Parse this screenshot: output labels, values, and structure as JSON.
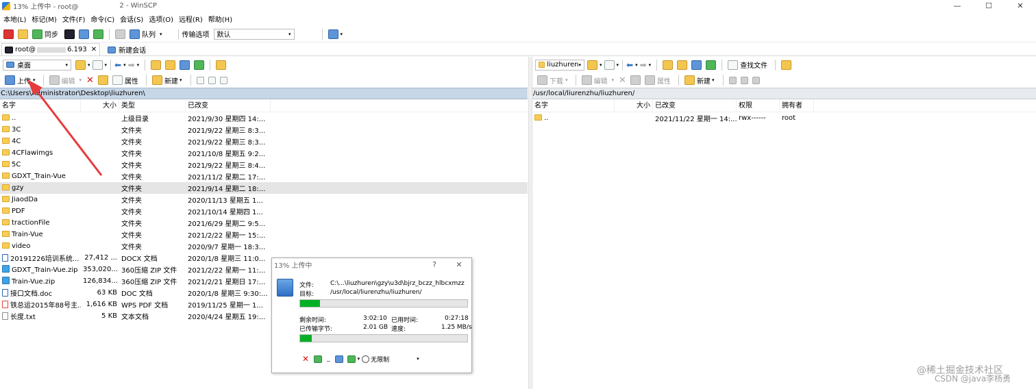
{
  "window": {
    "title": "13% 上传中 - root@",
    "title_tail": "2 - WinSCP",
    "controls": [
      "—",
      "☐",
      "✕"
    ]
  },
  "menu": [
    "本地(L)",
    "标记(M)",
    "文件(F)",
    "命令(C)",
    "会话(S)",
    "选项(O)",
    "远程(R)",
    "帮助(H)"
  ],
  "toolbar": {
    "sync_label": "同步",
    "queue_label": "队列",
    "transfer_label": "传输选项",
    "transfer_value": "默认"
  },
  "tabs": [
    {
      "label": "root@",
      "label_tail": "6.193"
    },
    {
      "label": "新建会话"
    }
  ],
  "left": {
    "location": "桌面",
    "upload_label": "上传",
    "edit_label": "编辑",
    "properties_label": "属性",
    "new_label": "新建",
    "path": "C:\\Users\\Administrator\\Desktop\\liuzhuren\\",
    "columns": [
      "名字",
      "大小",
      "类型",
      "已改变"
    ],
    "rows": [
      {
        "icon": "up",
        "name": "..",
        "size": "",
        "type": "上级目录",
        "date": "2021/9/30 星期四 14:..."
      },
      {
        "icon": "folder",
        "name": "3C",
        "size": "",
        "type": "文件夹",
        "date": "2021/9/22 星期三 8:3..."
      },
      {
        "icon": "folder",
        "name": "4C",
        "size": "",
        "type": "文件夹",
        "date": "2021/9/22 星期三 8:3..."
      },
      {
        "icon": "folder",
        "name": "4CFlawimgs",
        "size": "",
        "type": "文件夹",
        "date": "2021/10/8 星期五 9:2..."
      },
      {
        "icon": "folder",
        "name": "5C",
        "size": "",
        "type": "文件夹",
        "date": "2021/9/22 星期三 8:4..."
      },
      {
        "icon": "folder",
        "name": "GDXT_Train-Vue",
        "size": "",
        "type": "文件夹",
        "date": "2021/11/2 星期二 17:..."
      },
      {
        "icon": "folder",
        "name": "gzy",
        "size": "",
        "type": "文件夹",
        "date": "2021/9/14 星期二 18:..."
      },
      {
        "icon": "folder",
        "name": "JiaodDa",
        "size": "",
        "type": "文件夹",
        "date": "2020/11/13 星期五 1..."
      },
      {
        "icon": "folder",
        "name": "PDF",
        "size": "",
        "type": "文件夹",
        "date": "2021/10/14 星期四 1..."
      },
      {
        "icon": "folder",
        "name": "tractionFile",
        "size": "",
        "type": "文件夹",
        "date": "2021/6/29 星期二 9:5..."
      },
      {
        "icon": "folder",
        "name": "Train-Vue",
        "size": "",
        "type": "文件夹",
        "date": "2021/2/22 星期一 15:..."
      },
      {
        "icon": "folder",
        "name": "video",
        "size": "",
        "type": "文件夹",
        "date": "2020/9/7 星期一 18:3..."
      },
      {
        "icon": "doc",
        "name": "20191226培训系统...",
        "size": "27,412 ...",
        "type": "DOCX 文档",
        "date": "2020/1/8 星期三 11:0..."
      },
      {
        "icon": "zip",
        "name": "GDXT_Train-Vue.zip",
        "size": "353,020...",
        "type": "360压缩 ZIP 文件",
        "date": "2021/2/22 星期一 11:..."
      },
      {
        "icon": "zip",
        "name": "Train-Vue.zip",
        "size": "126,834...",
        "type": "360压缩 ZIP 文件",
        "date": "2021/2/21 星期日 17:..."
      },
      {
        "icon": "doc",
        "name": "接口文档.doc",
        "size": "63 KB",
        "type": "DOC 文档",
        "date": "2020/1/8 星期三 9:30:..."
      },
      {
        "icon": "pdf",
        "name": "铁总运2015年88号主...",
        "size": "1,616 KB",
        "type": "WPS PDF 文档",
        "date": "2019/11/25 星期一 1..."
      },
      {
        "icon": "txt",
        "name": "长度.txt",
        "size": "5 KB",
        "type": "文本文档",
        "date": "2020/4/24 星期五 19:..."
      }
    ]
  },
  "right": {
    "location": "liuzhuren",
    "download_label": "下载",
    "edit_label": "编辑",
    "properties_label": "属性",
    "new_label": "新建",
    "find_label": "查找文件",
    "path": "/usr/local/liurenzhu/liuzhuren/",
    "columns": [
      "名字",
      "大小",
      "已改变",
      "权限",
      "拥有者"
    ],
    "rows": [
      {
        "name": "..",
        "size": "",
        "date": "2021/11/22 星期一 14:...",
        "perm": "rwx------",
        "owner": "root"
      }
    ]
  },
  "dialog": {
    "title": "13% 上传中",
    "help": "?",
    "close": "✕",
    "file_label": "文件:",
    "file_value": "C:\\...\\liuzhuren\\gzy\\u3d\\bjrz_bczz_hlbcxmzz",
    "target_label": "目标:",
    "target_value": "/usr/local/liurenzhu/liuzhuren/",
    "file_progress": 0.12,
    "remaining_label": "剩余时间:",
    "remaining_value": "3:02:10",
    "elapsed_label": "已用时间:",
    "elapsed_value": "0:27:18",
    "transferred_label": "已传输字节:",
    "transferred_value": "2.01 GB",
    "speed_label": "速度:",
    "speed_value": "1.25 MB/s",
    "total_progress": 0.07,
    "limit_label": "无限制"
  },
  "watermark": {
    "line1": "@稀土掘金技术社区",
    "line2": "CSDN @java李杨勇"
  }
}
